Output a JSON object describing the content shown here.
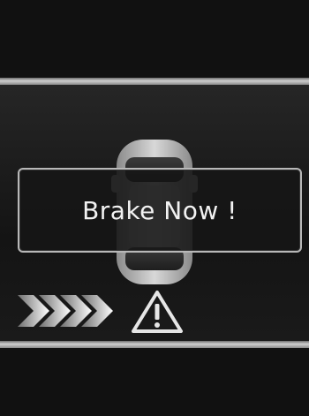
{
  "alert": {
    "message": "Brake Now !"
  },
  "icons": {
    "vehicle": "car-top-view-icon",
    "approach": "chevrons-right-icon",
    "warning": "warning-triangle-icon"
  },
  "colors": {
    "background": "#111111",
    "text": "#f2f2f2",
    "accent": "#d9d9d9"
  }
}
